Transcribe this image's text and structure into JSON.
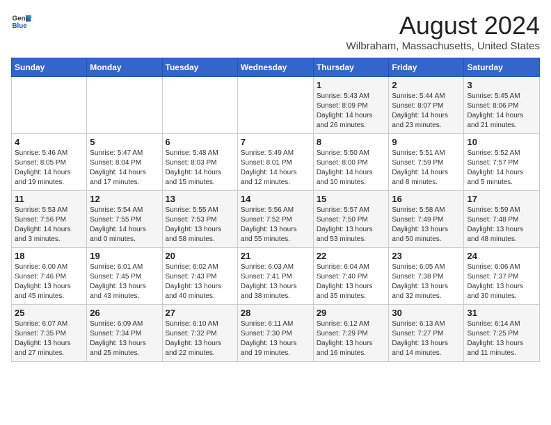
{
  "header": {
    "logo_general": "General",
    "logo_blue": "Blue",
    "month": "August 2024",
    "location": "Wilbraham, Massachusetts, United States"
  },
  "weekdays": [
    "Sunday",
    "Monday",
    "Tuesday",
    "Wednesday",
    "Thursday",
    "Friday",
    "Saturday"
  ],
  "weeks": [
    [
      {
        "day": "",
        "info": ""
      },
      {
        "day": "",
        "info": ""
      },
      {
        "day": "",
        "info": ""
      },
      {
        "day": "",
        "info": ""
      },
      {
        "day": "1",
        "info": "Sunrise: 5:43 AM\nSunset: 8:09 PM\nDaylight: 14 hours\nand 26 minutes."
      },
      {
        "day": "2",
        "info": "Sunrise: 5:44 AM\nSunset: 8:07 PM\nDaylight: 14 hours\nand 23 minutes."
      },
      {
        "day": "3",
        "info": "Sunrise: 5:45 AM\nSunset: 8:06 PM\nDaylight: 14 hours\nand 21 minutes."
      }
    ],
    [
      {
        "day": "4",
        "info": "Sunrise: 5:46 AM\nSunset: 8:05 PM\nDaylight: 14 hours\nand 19 minutes."
      },
      {
        "day": "5",
        "info": "Sunrise: 5:47 AM\nSunset: 8:04 PM\nDaylight: 14 hours\nand 17 minutes."
      },
      {
        "day": "6",
        "info": "Sunrise: 5:48 AM\nSunset: 8:03 PM\nDaylight: 14 hours\nand 15 minutes."
      },
      {
        "day": "7",
        "info": "Sunrise: 5:49 AM\nSunset: 8:01 PM\nDaylight: 14 hours\nand 12 minutes."
      },
      {
        "day": "8",
        "info": "Sunrise: 5:50 AM\nSunset: 8:00 PM\nDaylight: 14 hours\nand 10 minutes."
      },
      {
        "day": "9",
        "info": "Sunrise: 5:51 AM\nSunset: 7:59 PM\nDaylight: 14 hours\nand 8 minutes."
      },
      {
        "day": "10",
        "info": "Sunrise: 5:52 AM\nSunset: 7:57 PM\nDaylight: 14 hours\nand 5 minutes."
      }
    ],
    [
      {
        "day": "11",
        "info": "Sunrise: 5:53 AM\nSunset: 7:56 PM\nDaylight: 14 hours\nand 3 minutes."
      },
      {
        "day": "12",
        "info": "Sunrise: 5:54 AM\nSunset: 7:55 PM\nDaylight: 14 hours\nand 0 minutes."
      },
      {
        "day": "13",
        "info": "Sunrise: 5:55 AM\nSunset: 7:53 PM\nDaylight: 13 hours\nand 58 minutes."
      },
      {
        "day": "14",
        "info": "Sunrise: 5:56 AM\nSunset: 7:52 PM\nDaylight: 13 hours\nand 55 minutes."
      },
      {
        "day": "15",
        "info": "Sunrise: 5:57 AM\nSunset: 7:50 PM\nDaylight: 13 hours\nand 53 minutes."
      },
      {
        "day": "16",
        "info": "Sunrise: 5:58 AM\nSunset: 7:49 PM\nDaylight: 13 hours\nand 50 minutes."
      },
      {
        "day": "17",
        "info": "Sunrise: 5:59 AM\nSunset: 7:48 PM\nDaylight: 13 hours\nand 48 minutes."
      }
    ],
    [
      {
        "day": "18",
        "info": "Sunrise: 6:00 AM\nSunset: 7:46 PM\nDaylight: 13 hours\nand 45 minutes."
      },
      {
        "day": "19",
        "info": "Sunrise: 6:01 AM\nSunset: 7:45 PM\nDaylight: 13 hours\nand 43 minutes."
      },
      {
        "day": "20",
        "info": "Sunrise: 6:02 AM\nSunset: 7:43 PM\nDaylight: 13 hours\nand 40 minutes."
      },
      {
        "day": "21",
        "info": "Sunrise: 6:03 AM\nSunset: 7:41 PM\nDaylight: 13 hours\nand 38 minutes."
      },
      {
        "day": "22",
        "info": "Sunrise: 6:04 AM\nSunset: 7:40 PM\nDaylight: 13 hours\nand 35 minutes."
      },
      {
        "day": "23",
        "info": "Sunrise: 6:05 AM\nSunset: 7:38 PM\nDaylight: 13 hours\nand 32 minutes."
      },
      {
        "day": "24",
        "info": "Sunrise: 6:06 AM\nSunset: 7:37 PM\nDaylight: 13 hours\nand 30 minutes."
      }
    ],
    [
      {
        "day": "25",
        "info": "Sunrise: 6:07 AM\nSunset: 7:35 PM\nDaylight: 13 hours\nand 27 minutes."
      },
      {
        "day": "26",
        "info": "Sunrise: 6:09 AM\nSunset: 7:34 PM\nDaylight: 13 hours\nand 25 minutes."
      },
      {
        "day": "27",
        "info": "Sunrise: 6:10 AM\nSunset: 7:32 PM\nDaylight: 13 hours\nand 22 minutes."
      },
      {
        "day": "28",
        "info": "Sunrise: 6:11 AM\nSunset: 7:30 PM\nDaylight: 13 hours\nand 19 minutes."
      },
      {
        "day": "29",
        "info": "Sunrise: 6:12 AM\nSunset: 7:29 PM\nDaylight: 13 hours\nand 16 minutes."
      },
      {
        "day": "30",
        "info": "Sunrise: 6:13 AM\nSunset: 7:27 PM\nDaylight: 13 hours\nand 14 minutes."
      },
      {
        "day": "31",
        "info": "Sunrise: 6:14 AM\nSunset: 7:25 PM\nDaylight: 13 hours\nand 11 minutes."
      }
    ]
  ]
}
